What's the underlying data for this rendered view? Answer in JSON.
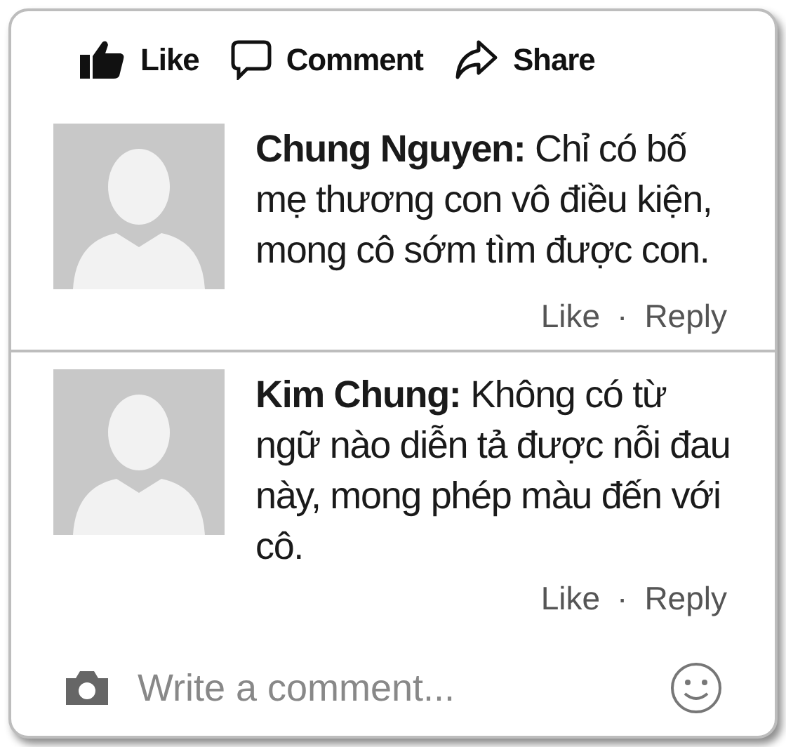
{
  "actions": [
    {
      "kind": "like",
      "label": "Like"
    },
    {
      "kind": "comment",
      "label": "Comment"
    },
    {
      "kind": "share",
      "label": "Share"
    }
  ],
  "comments": [
    {
      "author": "Chung Nguyen:",
      "text": "Chỉ có bố mẹ thương con vô điều kiện, mong cô sớm tìm được con.",
      "like": "Like",
      "separator": "·",
      "reply": "Reply"
    },
    {
      "author": "Kim Chung:",
      "text": "Không có từ ngữ nào diễn tả được nỗi đau này, mong phép màu đến với cô.",
      "like": "Like",
      "separator": "·",
      "reply": "Reply"
    }
  ],
  "composer": {
    "placeholder": "Write a comment..."
  }
}
